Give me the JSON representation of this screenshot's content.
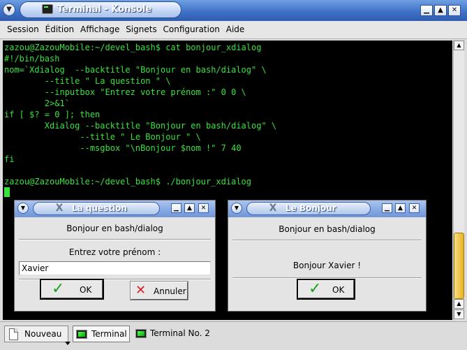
{
  "window": {
    "title": "Terminal - Konsole",
    "menu": [
      "Session",
      "Édition",
      "Affichage",
      "Signets",
      "Configuration",
      "Aide"
    ]
  },
  "terminal": {
    "lines": [
      "zazou@ZazouMobile:~/devel_bash$ cat bonjour_xdialog",
      "#!/bin/bash",
      "nom=`Xdialog  --backtitle \"Bonjour en bash/dialog\" \\",
      "        --title \" La question \" \\",
      "        --inputbox \"Entrez votre prénom :\" 0 0 \\",
      "        2>&1`",
      "if [ $? = 0 ]; then",
      "        Xdialog --backtitle \"Bonjour en bash/dialog\" \\",
      "               --title \" Le Bonjour \" \\",
      "               --msgbox \"\\nBonjour $nom !\" 7 40",
      "fi",
      "",
      "zazou@ZazouMobile:~/devel_bash$ ./bonjour_xdialog"
    ],
    "text_color": "#37e23a",
    "background": "#000000"
  },
  "dialog_question": {
    "title": "La question",
    "backtitle": "Bonjour en bash/dialog",
    "prompt": "Entrez votre prénom :",
    "input_value": "Xavier",
    "ok_label": "OK",
    "cancel_label": "Annuler"
  },
  "dialog_bonjour": {
    "title": "Le Bonjour",
    "backtitle": "Bonjour en bash/dialog",
    "message": "Bonjour Xavier !",
    "ok_label": "OK"
  },
  "tabbar": {
    "new_label": "Nouveau",
    "tabs": [
      "Terminal",
      "Terminal No. 2"
    ]
  }
}
